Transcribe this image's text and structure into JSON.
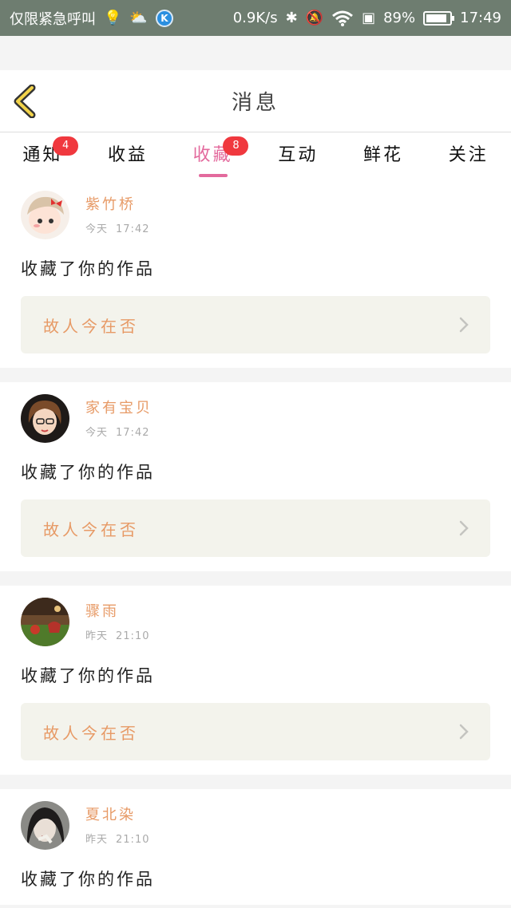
{
  "status_bar": {
    "carrier": "仅限紧急呼叫",
    "speed": "0.9K/s",
    "battery": "89%",
    "battery_level": 0.89,
    "time": "17:49",
    "icons": [
      "bulb-icon",
      "weather-icon",
      "k-app-icon",
      "bluetooth-icon",
      "silent-icon",
      "wifi-icon",
      "sim-icon",
      "battery-icon"
    ]
  },
  "header": {
    "title": "消息",
    "back_icon": "chevron-left-icon"
  },
  "tabs": [
    {
      "label": "通知",
      "badge": "4",
      "active": false
    },
    {
      "label": "收益",
      "badge": "",
      "active": false
    },
    {
      "label": "收藏",
      "badge": "8",
      "active": true
    },
    {
      "label": "互动",
      "badge": "",
      "active": false
    },
    {
      "label": "鲜花",
      "badge": "",
      "active": false
    },
    {
      "label": "关注",
      "badge": "",
      "active": false
    }
  ],
  "feed": [
    {
      "username": "紫竹桥",
      "day": "今天",
      "time": "17:42",
      "action": "收藏了你的作品",
      "work": "故人今在否"
    },
    {
      "username": "家有宝贝",
      "day": "今天",
      "time": "17:42",
      "action": "收藏了你的作品",
      "work": "故人今在否"
    },
    {
      "username": "骤雨",
      "day": "昨天",
      "time": "21:10",
      "action": "收藏了你的作品",
      "work": "故人今在否"
    },
    {
      "username": "夏北染",
      "day": "昨天",
      "time": "21:10",
      "action": "收藏了你的作品",
      "work": ""
    }
  ],
  "colors": {
    "accent": "#e36a9d",
    "username": "#e79a66",
    "badge": "#f0383e",
    "statusbar": "#6e7d70"
  }
}
